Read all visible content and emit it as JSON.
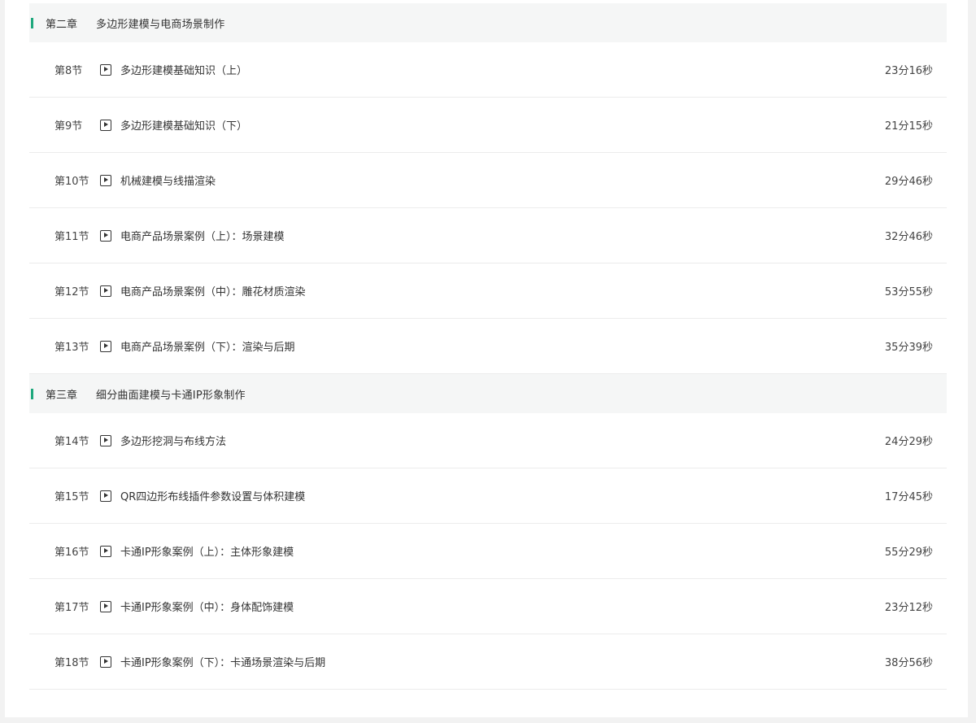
{
  "chapters": [
    {
      "number": "第二章",
      "title": "多边形建模与电商场景制作",
      "lessons": [
        {
          "number": "第8节",
          "title": "多边形建模基础知识（上）",
          "duration": "23分16秒"
        },
        {
          "number": "第9节",
          "title": "多边形建模基础知识（下）",
          "duration": "21分15秒"
        },
        {
          "number": "第10节",
          "title": "机械建模与线描渲染",
          "duration": "29分46秒"
        },
        {
          "number": "第11节",
          "title": "电商产品场景案例（上）：场景建模",
          "duration": "32分46秒"
        },
        {
          "number": "第12节",
          "title": "电商产品场景案例（中）：雕花材质渲染",
          "duration": "53分55秒"
        },
        {
          "number": "第13节",
          "title": "电商产品场景案例（下）：渲染与后期",
          "duration": "35分39秒"
        }
      ]
    },
    {
      "number": "第三章",
      "title": "细分曲面建模与卡通IP形象制作",
      "lessons": [
        {
          "number": "第14节",
          "title": "多边形挖洞与布线方法",
          "duration": "24分29秒"
        },
        {
          "number": "第15节",
          "title": "QR四边形布线插件参数设置与体积建模",
          "duration": "17分45秒"
        },
        {
          "number": "第16节",
          "title": "卡通IP形象案例（上）：主体形象建模",
          "duration": "55分29秒"
        },
        {
          "number": "第17节",
          "title": "卡通IP形象案例（中）：身体配饰建模",
          "duration": "23分12秒"
        },
        {
          "number": "第18节",
          "title": "卡通IP形象案例（下）：卡通场景渲染与后期",
          "duration": "38分56秒"
        }
      ]
    }
  ],
  "icons": {
    "lesson": "play-video-icon"
  },
  "colors": {
    "accent": "#1fa87d",
    "chapter_bg": "#f5f6f6"
  }
}
